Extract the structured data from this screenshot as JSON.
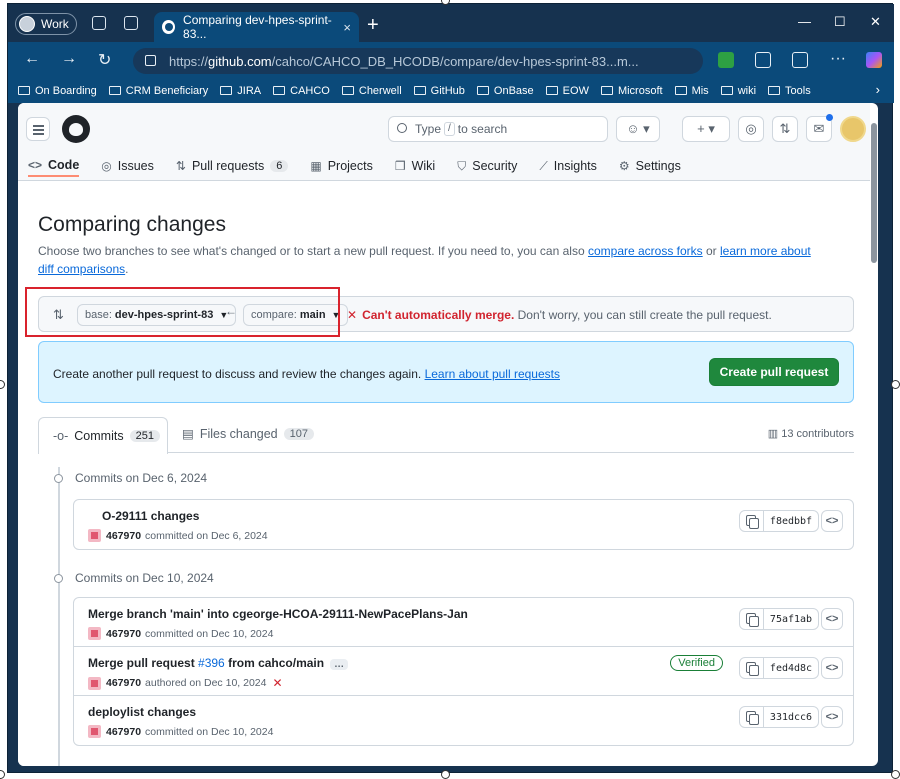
{
  "browser": {
    "profile": "Work",
    "tab_title": "Comparing dev-hpes-sprint-83...",
    "tab_close": "×",
    "new_tab": "+",
    "url_prefix": "https://",
    "url_host": "github.com",
    "url_path": "/cahco/CAHCO_DB_HCODB/compare/dev-hpes-sprint-83...m...",
    "bookmarks": [
      "On Boarding",
      "CRM Beneficiary",
      "JIRA",
      "CAHCO",
      "Cherwell",
      "GitHub",
      "OnBase",
      "EOW",
      "Microsoft",
      "Mis",
      "wiki",
      "Tools"
    ]
  },
  "header": {
    "search_placeholder_pre": "Type",
    "search_key": "/",
    "search_placeholder_post": "to search"
  },
  "repo_nav": [
    {
      "label": "Code",
      "icon": "<>",
      "active": true
    },
    {
      "label": "Issues",
      "icon": "◎"
    },
    {
      "label": "Pull requests",
      "icon": "⇅",
      "count": "6"
    },
    {
      "label": "Projects",
      "icon": "▦"
    },
    {
      "label": "Wiki",
      "icon": "❒"
    },
    {
      "label": "Security",
      "icon": "⛉"
    },
    {
      "label": "Insights",
      "icon": "⟋"
    },
    {
      "label": "Settings",
      "icon": "⚙"
    }
  ],
  "compare": {
    "title": "Comparing changes",
    "desc_1": "Choose two branches to see what's changed or to start a new pull request. If you need to, you can also ",
    "desc_link1": "compare across forks",
    "desc_2": " or ",
    "desc_link2": "learn more about diff comparisons",
    "desc_3": ".",
    "base_label": "base:",
    "base_value": "dev-hpes-sprint-83",
    "compare_label": "compare:",
    "compare_value": "main",
    "merge_status": "Can't automatically merge.",
    "merge_note": " Don't worry, you can still create the pull request."
  },
  "flash": {
    "text": "Create another pull request to discuss and review the changes again. ",
    "link": "Learn about pull requests",
    "button": "Create pull request"
  },
  "tabs": {
    "commits_label": "Commits",
    "commits_count": "251",
    "files_label": "Files changed",
    "files_count": "107",
    "contributors": "13 contributors"
  },
  "groups": [
    {
      "date": "Commits on Dec 6, 2024",
      "commits": [
        {
          "message": "O-29111 changes",
          "author": "467970",
          "action": "committed on Dec 6, 2024",
          "sha": "f8edbbf"
        }
      ]
    },
    {
      "date": "Commits on Dec 10, 2024",
      "commits": [
        {
          "message": "Merge branch 'main' into cgeorge-HCOA-29111-NewPacePlans-Jan",
          "author": "467970",
          "action": "committed on Dec 10, 2024",
          "sha": "75af1ab"
        },
        {
          "message_pre": "Merge pull request ",
          "message_link": "#396",
          "message_post": " from cahco/main",
          "author": "467970",
          "action": "authored on Dec 10, 2024",
          "sha": "fed4d8c",
          "verified": "Verified",
          "ellipsis": "…",
          "failed": "✕"
        },
        {
          "message": "deploylist changes",
          "author": "467970",
          "action": "committed on Dec 10, 2024",
          "sha": "331dcc6"
        }
      ]
    }
  ],
  "colors": {
    "accent": "#1f883d",
    "link": "#0969da",
    "error": "#d1242f",
    "browser_chrome": "#16324f"
  }
}
